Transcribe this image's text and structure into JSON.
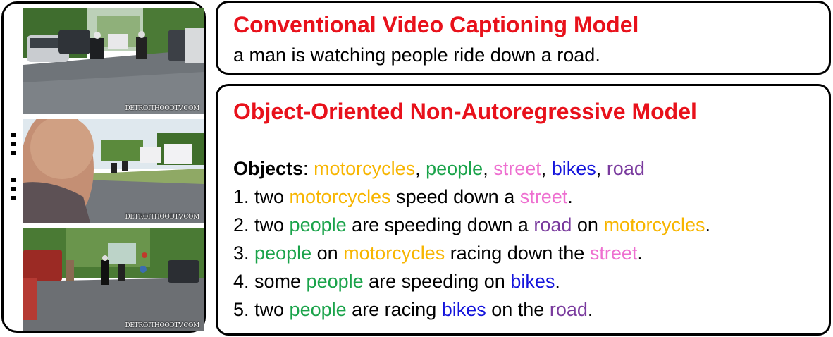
{
  "frames": {
    "watermark": "DETROITHOODTV.COM",
    "items": [
      {
        "name": "frame-street-riders"
      },
      {
        "name": "frame-man-watching"
      },
      {
        "name": "frame-street-bikers"
      }
    ]
  },
  "conventional": {
    "title": "Conventional Video Captioning Model",
    "caption": "a man is watching people ride down a road."
  },
  "nar": {
    "title": "Object-Oriented Non-Autoregressive Model",
    "objects_label": "Objects",
    "object_colors": {
      "motorcycles": "#f7b500",
      "people": "#1aa34a",
      "street": "#ee6fd0",
      "bikes": "#1414dc",
      "road": "#7a3b9e"
    },
    "objects": [
      "motorcycles",
      "people",
      "street",
      "bikes",
      "road"
    ],
    "captions": [
      [
        {
          "t": "1. two "
        },
        {
          "t": "motorcycles",
          "o": "motorcycles"
        },
        {
          "t": " speed down a "
        },
        {
          "t": "street",
          "o": "street"
        },
        {
          "t": "."
        }
      ],
      [
        {
          "t": "2. two "
        },
        {
          "t": "people",
          "o": "people"
        },
        {
          "t": " are speeding down a "
        },
        {
          "t": "road",
          "o": "road"
        },
        {
          "t": " on "
        },
        {
          "t": "motorcycles",
          "o": "motorcycles"
        },
        {
          "t": "."
        }
      ],
      [
        {
          "t": "3. "
        },
        {
          "t": "people",
          "o": "people"
        },
        {
          "t": " on "
        },
        {
          "t": "motorcycles",
          "o": "motorcycles"
        },
        {
          "t": " racing down the "
        },
        {
          "t": "street",
          "o": "street"
        },
        {
          "t": "."
        }
      ],
      [
        {
          "t": "4. some "
        },
        {
          "t": "people",
          "o": "people"
        },
        {
          "t": " are speeding on "
        },
        {
          "t": "bikes",
          "o": "bikes"
        },
        {
          "t": "."
        }
      ],
      [
        {
          "t": "5. two "
        },
        {
          "t": "people",
          "o": "people"
        },
        {
          "t": " are racing "
        },
        {
          "t": "bikes",
          "o": "bikes"
        },
        {
          "t": " on the "
        },
        {
          "t": "road",
          "o": "road"
        },
        {
          "t": "."
        }
      ]
    ]
  }
}
